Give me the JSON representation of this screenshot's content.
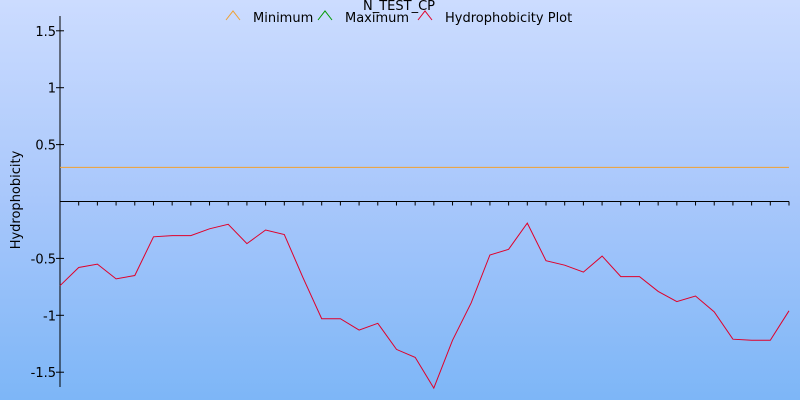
{
  "chart_data": {
    "type": "line",
    "title": "N_TEST_CP",
    "xlabel": "",
    "ylabel": "Hydrophobicity",
    "ylim": [
      -1.63,
      1.63
    ],
    "y_ticks": [
      {
        "value": 1.5,
        "label": "1.5"
      },
      {
        "value": 1,
        "label": "1"
      },
      {
        "value": 0.5,
        "label": "0.5"
      },
      {
        "value": -0.5,
        "label": "-0.5"
      },
      {
        "value": -1,
        "label": "-1"
      },
      {
        "value": -1.5,
        "label": "-1.5"
      }
    ],
    "x_tick_count": 40,
    "legend": {
      "placement": "top-center"
    },
    "colors": {
      "minimum": "#f0a030",
      "maximum": "#009900",
      "plot": "#e0002a"
    },
    "series": [
      {
        "key": "minimum",
        "name": "Minimum",
        "values": [
          0.3,
          0.3
        ]
      },
      {
        "key": "maximum",
        "name": "Maximum",
        "values": []
      },
      {
        "key": "plot",
        "name": "Hydrophobicity Plot",
        "values": [
          -0.74,
          -0.58,
          -0.55,
          -0.68,
          -0.65,
          -0.31,
          -0.3,
          -0.3,
          -0.24,
          -0.2,
          -0.37,
          -0.25,
          -0.29,
          -0.67,
          -1.03,
          -1.03,
          -1.13,
          -1.07,
          -1.3,
          -1.37,
          -1.64,
          -1.22,
          -0.89,
          -0.47,
          -0.42,
          -0.19,
          -0.52,
          -0.56,
          -0.62,
          -0.48,
          -0.66,
          -0.66,
          -0.79,
          -0.88,
          -0.83,
          -0.97,
          -1.21,
          -1.22,
          -1.22,
          -0.96
        ]
      }
    ]
  }
}
